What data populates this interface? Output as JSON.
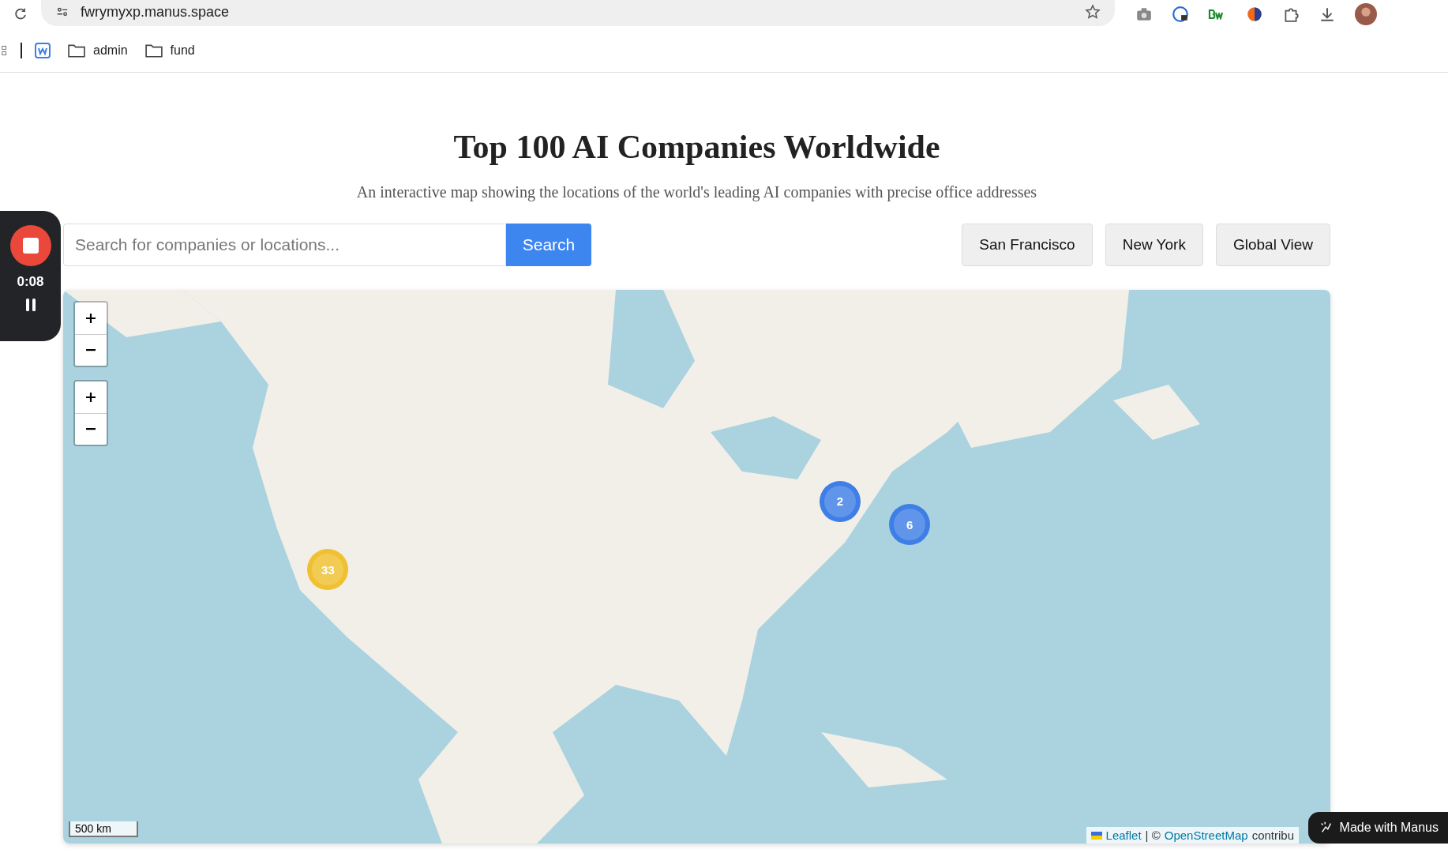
{
  "browser": {
    "url": "fwrymyxp.manus.space",
    "bookmarks": [
      "admin",
      "fund"
    ]
  },
  "page": {
    "title": "Top 100 AI Companies Worldwide",
    "subtitle": "An interactive map showing the locations of the world's leading AI companies with precise office addresses"
  },
  "search": {
    "placeholder": "Search for companies or locations...",
    "button": "Search"
  },
  "quick_views": [
    "San Francisco",
    "New York",
    "Global View"
  ],
  "recorder": {
    "time": "0:08"
  },
  "map": {
    "clusters": [
      {
        "count": "33",
        "color": "#f0c030"
      },
      {
        "count": "2",
        "color": "#3f7ee6"
      },
      {
        "count": "6",
        "color": "#3f7ee6"
      }
    ],
    "scale": "500 km",
    "attribution": {
      "leaflet": "Leaflet",
      "separator": "| ©",
      "osm": "OpenStreetMap",
      "rest": "contribu"
    }
  },
  "badge": "Made with Manus"
}
